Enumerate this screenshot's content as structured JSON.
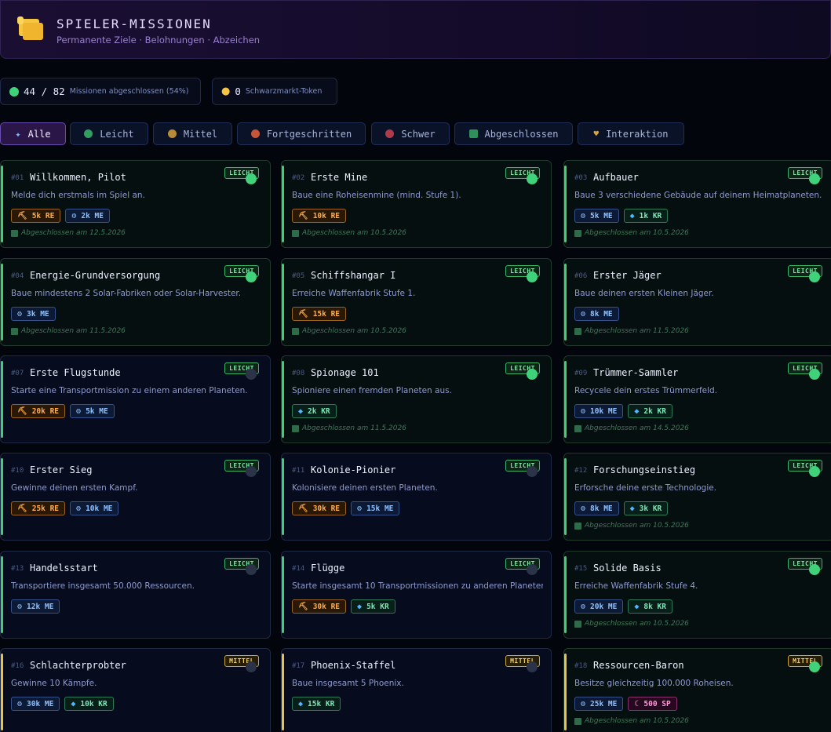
{
  "header": {
    "title": "SPIELER-MISSIONEN",
    "subtitle": "Permanente Ziele · Belohnungen · Abzeichen",
    "icon": "scroll-icon"
  },
  "stats": {
    "completed_text": "44 / 82",
    "completed_label": "Missionen abgeschlossen (54%)",
    "tokens_value": "0",
    "tokens_label": "Schwarzmarkt-Token"
  },
  "filters": [
    {
      "label": "Alle",
      "active": true,
      "icon": "sparkle-icon"
    },
    {
      "label": "Leicht",
      "color": "#2f9e5f"
    },
    {
      "label": "Mittel",
      "color": "#b98a3a"
    },
    {
      "label": "Fortgeschritten",
      "color": "#c4573a"
    },
    {
      "label": "Schwer",
      "color": "#b03a4a"
    },
    {
      "label": "Abgeschlossen",
      "icon": "checkbox-icon"
    },
    {
      "label": "Interaktion",
      "icon": "heart-icon"
    }
  ],
  "cards": [
    {
      "num": "#01",
      "title": "Willkommen, Pilot",
      "desc": "Melde dich erstmals im Spiel an.",
      "badge": "LEICHT",
      "done": true,
      "rewards": [
        {
          "type": "re",
          "text": "5k RE"
        },
        {
          "type": "me",
          "text": "2k ME"
        }
      ],
      "completed": "Abgeschlossen am 12.5.2026"
    },
    {
      "num": "#02",
      "title": "Erste Mine",
      "desc": "Baue eine Roheisenmine (mind. Stufe 1).",
      "badge": "LEICHT",
      "done": true,
      "rewards": [
        {
          "type": "re",
          "text": "10k RE"
        }
      ],
      "completed": "Abgeschlossen am 10.5.2026"
    },
    {
      "num": "#03",
      "title": "Aufbauer",
      "desc": "Baue 3 verschiedene Gebäude auf deinem Heimatplaneten.",
      "badge": "LEICHT",
      "done": true,
      "rewards": [
        {
          "type": "me",
          "text": "5k ME"
        },
        {
          "type": "kr",
          "text": "1k KR"
        }
      ],
      "completed": "Abgeschlossen am 10.5.2026"
    },
    {
      "num": "#04",
      "title": "Energie-Grundversorgung",
      "desc": "Baue mindestens 2 Solar-Fabriken oder Solar-Harvester.",
      "badge": "LEICHT",
      "done": true,
      "rewards": [
        {
          "type": "me",
          "text": "3k ME"
        }
      ],
      "completed": "Abgeschlossen am 11.5.2026"
    },
    {
      "num": "#05",
      "title": "Schiffshangar I",
      "desc": "Erreiche Waffenfabrik Stufe 1.",
      "badge": "LEICHT",
      "done": true,
      "rewards": [
        {
          "type": "re",
          "text": "15k RE"
        }
      ],
      "completed": "Abgeschlossen am 10.5.2026"
    },
    {
      "num": "#06",
      "title": "Erster Jäger",
      "desc": "Baue deinen ersten Kleinen Jäger.",
      "badge": "LEICHT",
      "done": true,
      "rewards": [
        {
          "type": "me",
          "text": "8k ME"
        }
      ],
      "completed": "Abgeschlossen am 11.5.2026"
    },
    {
      "num": "#07",
      "title": "Erste Flugstunde",
      "desc": "Starte eine Transportmission zu einem anderen Planeten.",
      "badge": "LEICHT",
      "done": false,
      "rewards": [
        {
          "type": "re",
          "text": "20k RE"
        },
        {
          "type": "me",
          "text": "5k ME"
        }
      ],
      "completed": ""
    },
    {
      "num": "#08",
      "title": "Spionage 101",
      "desc": "Spioniere einen fremden Planeten aus.",
      "badge": "LEICHT",
      "done": true,
      "rewards": [
        {
          "type": "kr",
          "text": "2k KR"
        }
      ],
      "completed": "Abgeschlossen am 11.5.2026"
    },
    {
      "num": "#09",
      "title": "Trümmer-Sammler",
      "desc": "Recycele dein erstes Trümmerfeld.",
      "badge": "LEICHT",
      "done": true,
      "rewards": [
        {
          "type": "me",
          "text": "10k ME"
        },
        {
          "type": "kr",
          "text": "2k KR"
        }
      ],
      "completed": "Abgeschlossen am 14.5.2026"
    },
    {
      "num": "#10",
      "title": "Erster Sieg",
      "desc": "Gewinne deinen ersten Kampf.",
      "badge": "LEICHT",
      "done": false,
      "rewards": [
        {
          "type": "re",
          "text": "25k RE"
        },
        {
          "type": "me",
          "text": "10k ME"
        }
      ],
      "completed": ""
    },
    {
      "num": "#11",
      "title": "Kolonie-Pionier",
      "desc": "Kolonisiere deinen ersten Planeten.",
      "badge": "LEICHT",
      "done": false,
      "rewards": [
        {
          "type": "re",
          "text": "30k RE"
        },
        {
          "type": "me",
          "text": "15k ME"
        }
      ],
      "completed": ""
    },
    {
      "num": "#12",
      "title": "Forschungseinstieg",
      "desc": "Erforsche deine erste Technologie.",
      "badge": "LEICHT",
      "done": true,
      "rewards": [
        {
          "type": "me",
          "text": "8k ME"
        },
        {
          "type": "kr",
          "text": "3k KR"
        }
      ],
      "completed": "Abgeschlossen am 10.5.2026"
    },
    {
      "num": "#13",
      "title": "Handelsstart",
      "desc": "Transportiere insgesamt 50.000 Ressourcen.",
      "badge": "LEICHT",
      "done": false,
      "rewards": [
        {
          "type": "me",
          "text": "12k ME"
        }
      ],
      "completed": ""
    },
    {
      "num": "#14",
      "title": "Flügge",
      "desc": "Starte insgesamt 10 Transportmissionen zu anderen Planeten.",
      "badge": "LEICHT",
      "done": false,
      "rewards": [
        {
          "type": "re",
          "text": "30k RE"
        },
        {
          "type": "kr",
          "text": "5k KR"
        }
      ],
      "completed": ""
    },
    {
      "num": "#15",
      "title": "Solide Basis",
      "desc": "Erreiche Waffenfabrik Stufe 4.",
      "badge": "LEICHT",
      "done": true,
      "rewards": [
        {
          "type": "me",
          "text": "20k ME"
        },
        {
          "type": "kr",
          "text": "8k KR"
        }
      ],
      "completed": "Abgeschlossen am 10.5.2026"
    },
    {
      "num": "#16",
      "title": "Schlachterprobter",
      "desc": "Gewinne 10 Kämpfe.",
      "badge": "MITTEL",
      "done": false,
      "rewards": [
        {
          "type": "me",
          "text": "30k ME"
        },
        {
          "type": "kr",
          "text": "10k KR"
        }
      ],
      "completed": ""
    },
    {
      "num": "#17",
      "title": "Phoenix-Staffel",
      "desc": "Baue insgesamt 5 Phoenix.",
      "badge": "MITTEL",
      "done": false,
      "rewards": [
        {
          "type": "kr",
          "text": "15k KR"
        }
      ],
      "completed": ""
    },
    {
      "num": "#18",
      "title": "Ressourcen-Baron",
      "desc": "Besitze gleichzeitig 100.000 Roheisen.",
      "badge": "MITTEL",
      "done": true,
      "rewards": [
        {
          "type": "me",
          "text": "25k ME"
        },
        {
          "type": "sp",
          "text": "500 SP"
        }
      ],
      "completed": "Abgeschlossen am 10.5.2026"
    }
  ]
}
